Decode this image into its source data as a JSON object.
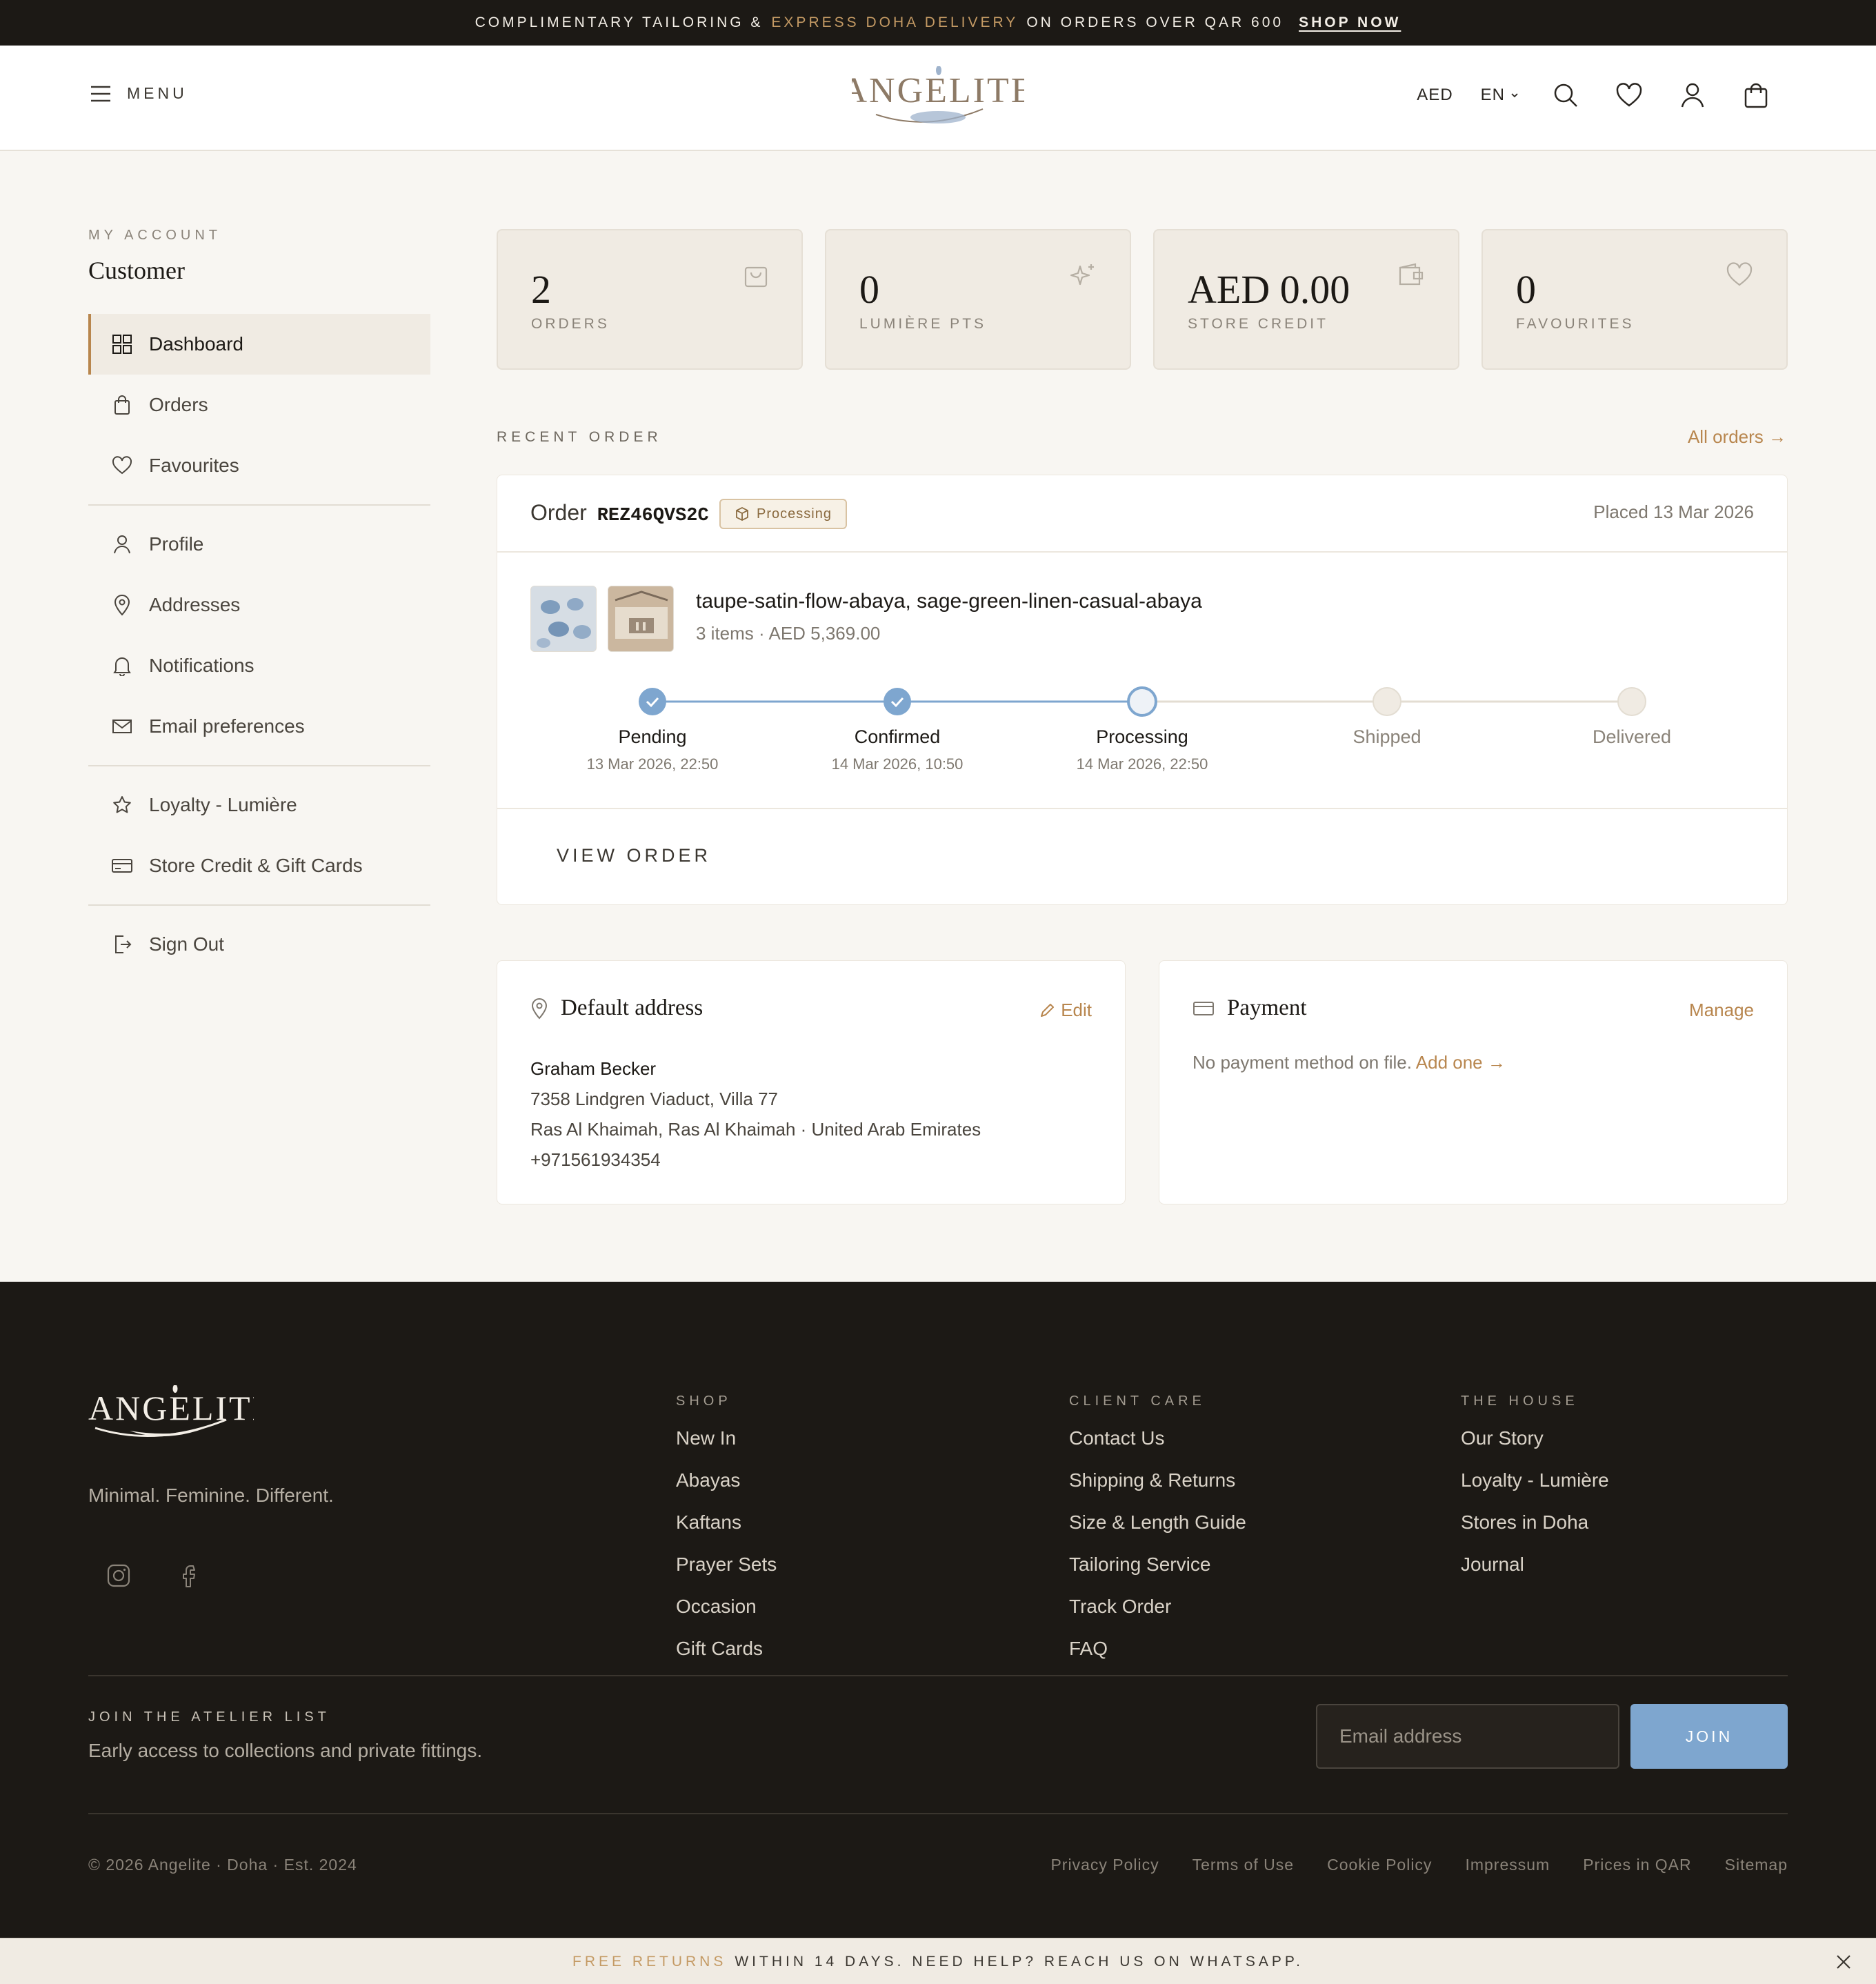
{
  "promo": {
    "part1": "COMPLIMENTARY TAILORING &",
    "highlight": "EXPRESS DOHA DELIVERY",
    "part2": "ON ORDERS OVER QAR 600",
    "cta": "SHOP NOW"
  },
  "header": {
    "menu_label": "MENU",
    "logo_text": "ANGELITE",
    "currency": "AED",
    "language": "EN",
    "icons": [
      "search-icon",
      "heart-icon",
      "user-icon",
      "bag-icon"
    ]
  },
  "sidebar": {
    "section_label": "MY ACCOUNT",
    "user_name": "Customer",
    "items": [
      {
        "label": "Dashboard",
        "icon": "grid-icon",
        "active": true
      },
      {
        "label": "Orders",
        "icon": "bag-icon"
      },
      {
        "label": "Favourites",
        "icon": "heart-icon"
      },
      {
        "label": "Profile",
        "icon": "user-icon"
      },
      {
        "label": "Addresses",
        "icon": "pin-icon"
      },
      {
        "label": "Notifications",
        "icon": "bell-icon"
      },
      {
        "label": "Email preferences",
        "icon": "mail-icon"
      },
      {
        "label": "Loyalty - Lumière",
        "icon": "star-icon"
      },
      {
        "label": "Store Credit & Gift Cards",
        "icon": "card-icon"
      },
      {
        "label": "Sign Out",
        "icon": "logout-icon"
      }
    ]
  },
  "stats": [
    {
      "value": "2",
      "label": "ORDERS",
      "icon": "bag-icon"
    },
    {
      "value": "0",
      "label": "LUMIÈRE PTS",
      "icon": "sparkle-icon"
    },
    {
      "value": "AED 0.00",
      "label": "STORE CREDIT",
      "icon": "wallet-icon"
    },
    {
      "value": "0",
      "label": "FAVOURITES",
      "icon": "heart-icon"
    }
  ],
  "recent_order": {
    "section_label": "RECENT ORDER",
    "all_orders_link": "All orders →",
    "order_prefix": "Order",
    "order_id": "REZ46QVS2C",
    "status_badge": "Processing",
    "placed": "Placed 13 Mar 2026",
    "products_title": "taupe-satin-flow-abaya, sage-green-linen-casual-abaya",
    "summary": "3 items · AED 5,369.00",
    "steps": [
      {
        "label": "Pending",
        "date": "13 Mar 2026, 22:50",
        "state": "done"
      },
      {
        "label": "Confirmed",
        "date": "14 Mar 2026, 10:50",
        "state": "done"
      },
      {
        "label": "Processing",
        "date": "14 Mar 2026, 22:50",
        "state": "current"
      },
      {
        "label": "Shipped",
        "date": "",
        "state": "todo"
      },
      {
        "label": "Delivered",
        "date": "",
        "state": "todo"
      }
    ],
    "view_button": "VIEW ORDER"
  },
  "address_card": {
    "title": "Default address",
    "action": "Edit",
    "name": "Graham Becker",
    "line1": "7358 Lindgren Viaduct, Villa 77",
    "line2": "Ras Al Khaimah, Ras Al Khaimah · United Arab Emirates",
    "phone": "+971561934354"
  },
  "payment_card": {
    "title": "Payment",
    "action": "Manage",
    "message": "No payment method on file.",
    "add_link": "Add one →"
  },
  "footer": {
    "logo_text": "ANGELITE",
    "tagline": "Minimal. Feminine. Different.",
    "social": [
      "instagram-icon",
      "facebook-icon"
    ],
    "columns": [
      {
        "heading": "SHOP",
        "links": [
          "New In",
          "Abayas",
          "Kaftans",
          "Prayer Sets",
          "Occasion",
          "Gift Cards"
        ]
      },
      {
        "heading": "CLIENT CARE",
        "links": [
          "Contact Us",
          "Shipping & Returns",
          "Size & Length Guide",
          "Tailoring Service",
          "Track Order",
          "FAQ"
        ]
      },
      {
        "heading": "THE HOUSE",
        "links": [
          "Our Story",
          "Loyalty - Lumière",
          "Stores in Doha",
          "Journal"
        ]
      }
    ],
    "newsletter": {
      "heading": "JOIN THE ATELIER LIST",
      "subtext": "Early access to collections and private fittings.",
      "placeholder": "Email address",
      "button": "JOIN"
    },
    "copyright": "© 2026 Angelite · Doha · Est. 2024",
    "legal_links": [
      "Privacy Policy",
      "Terms of Use",
      "Cookie Policy",
      "Impressum",
      "Prices in QAR",
      "Sitemap"
    ]
  },
  "bottom_banner": {
    "highlight": "FREE RETURNS",
    "text": "WITHIN 14 DAYS. NEED HELP? REACH US ON WHATSAPP."
  },
  "colors": {
    "accent_gold": "#b8864e",
    "progress_blue": "#7ea6cf",
    "dark": "#1c1915",
    "cream": "#f0ebe3"
  }
}
